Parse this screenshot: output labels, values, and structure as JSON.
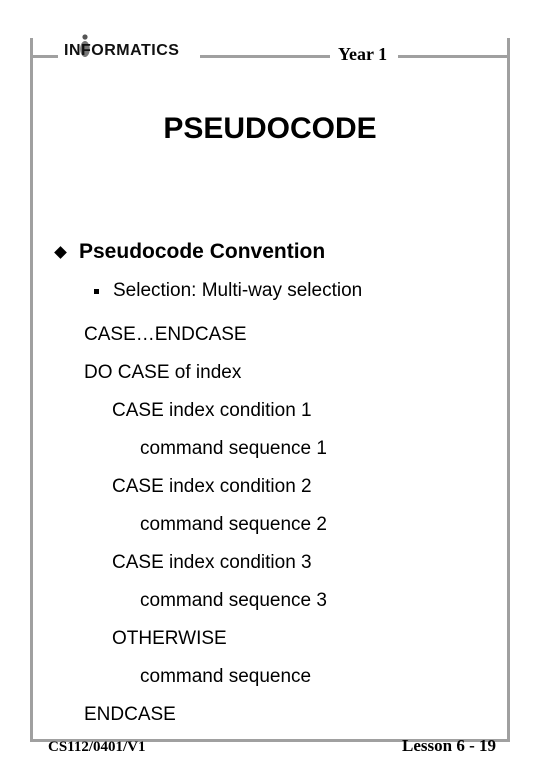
{
  "header": {
    "brand": "INFORMATICS",
    "year": "Year 1"
  },
  "title": "PSEUDOCODE",
  "section": {
    "heading": "Pseudocode Convention",
    "subheading": "Selection: Multi-way selection"
  },
  "code": {
    "l0": "CASE…ENDCASE",
    "l1": "DO CASE of index",
    "l2": "CASE index condition 1",
    "l3": "command sequence 1",
    "l4": "CASE index condition 2",
    "l5": "command sequence 2",
    "l6": "CASE index condition 3",
    "l7": "command sequence 3",
    "l8": "OTHERWISE",
    "l9": "command sequence",
    "l10": "ENDCASE"
  },
  "footer": {
    "left": "CS112/0401/V1",
    "right": "Lesson 6 - 19"
  }
}
